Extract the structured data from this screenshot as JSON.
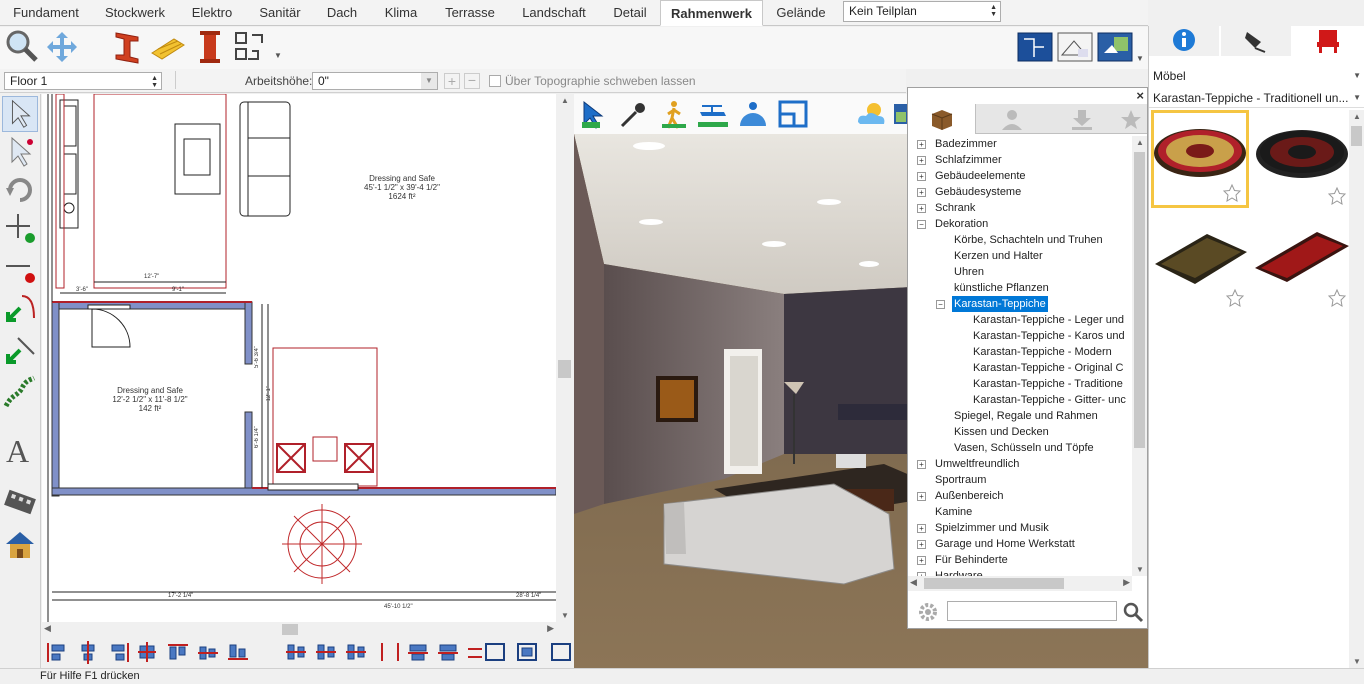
{
  "tabs": [
    {
      "label": "Fundament"
    },
    {
      "label": "Stockwerk"
    },
    {
      "label": "Elektro"
    },
    {
      "label": "Sanitär"
    },
    {
      "label": "Dach"
    },
    {
      "label": "Klima"
    },
    {
      "label": "Terrasse"
    },
    {
      "label": "Landschaft"
    },
    {
      "label": "Detail"
    },
    {
      "label": "Rahmenwerk"
    },
    {
      "label": "Gelände"
    }
  ],
  "active_tab": "Rahmenwerk",
  "plan_select": {
    "value": "Kein Teilplan"
  },
  "floor_select": {
    "value": "Floor 1"
  },
  "arbeitshoehe": {
    "label": "Arbeitshöhe:",
    "value": "0\""
  },
  "float_checkbox": {
    "label": "Über Topographie schweben lassen",
    "checked": false
  },
  "plan": {
    "room1": {
      "name": "Dressing and Safe",
      "dims": "45'-1 1/2\" x 39'-4 1/2\"",
      "area": "1624 ft²"
    },
    "room2": {
      "name": "Dressing and Safe",
      "dims": "12'-2 1/2\" x 11'-8 1/2\"",
      "area": "142 ft²"
    },
    "dims": {
      "d1": "12'-7\"",
      "d2": "9'-1\"",
      "d3": "3'-6\"",
      "d4": "5'-6 3/4\"",
      "d5": "12'-1\"",
      "d6": "6'-6 1/4\"",
      "d7": "17'-2 1/4\"",
      "d8": "45'-10 1/2\"",
      "d9": "28'-8 1/4\""
    }
  },
  "library": {
    "tree": [
      {
        "label": "Badezimmer",
        "level": 0,
        "expandable": true
      },
      {
        "label": "Schlafzimmer",
        "level": 0,
        "expandable": true
      },
      {
        "label": "Gebäudeelemente",
        "level": 0,
        "expandable": true
      },
      {
        "label": "Gebäudesysteme",
        "level": 0,
        "expandable": true
      },
      {
        "label": "Schrank",
        "level": 0,
        "expandable": true
      },
      {
        "label": "Dekoration",
        "level": 0,
        "expandable": true,
        "expanded": true
      },
      {
        "label": "Körbe, Schachteln und Truhen",
        "level": 1
      },
      {
        "label": "Kerzen und Halter",
        "level": 1
      },
      {
        "label": "Uhren",
        "level": 1
      },
      {
        "label": "künstliche Pflanzen",
        "level": 1
      },
      {
        "label": "Karastan-Teppiche",
        "level": 1,
        "expandable": true,
        "expanded": true,
        "selected": true
      },
      {
        "label": "Karastan-Teppiche - Leger und",
        "level": 2
      },
      {
        "label": "Karastan-Teppiche - Karos und",
        "level": 2
      },
      {
        "label": "Karastan-Teppiche - Modern",
        "level": 2
      },
      {
        "label": "Karastan-Teppiche - Original C",
        "level": 2
      },
      {
        "label": "Karastan-Teppiche - Traditione",
        "level": 2
      },
      {
        "label": "Karastan-Teppiche - Gitter- unc",
        "level": 2
      },
      {
        "label": "Spiegel, Regale und Rahmen",
        "level": 1
      },
      {
        "label": "Kissen und Decken",
        "level": 1
      },
      {
        "label": "Vasen, Schüsseln und Töpfe",
        "level": 1
      },
      {
        "label": "Umweltfreundlich",
        "level": 0,
        "expandable": true
      },
      {
        "label": "Sportraum",
        "level": 0
      },
      {
        "label": "Außenbereich",
        "level": 0,
        "expandable": true
      },
      {
        "label": "Kamine",
        "level": 0
      },
      {
        "label": "Spielzimmer und Musik",
        "level": 0,
        "expandable": true
      },
      {
        "label": "Garage und Home Werkstatt",
        "level": 0,
        "expandable": true
      },
      {
        "label": "Für Behinderte",
        "level": 0,
        "expandable": true
      },
      {
        "label": "Hardware",
        "level": 0,
        "expandable": true
      }
    ],
    "search_placeholder": ""
  },
  "right_panel": {
    "category": "Möbel",
    "subcategory": "Karastan-Teppiche - Traditionell un...",
    "thumbnails": [
      {
        "name": "round-rug-gold",
        "selected": true
      },
      {
        "name": "round-rug-dark",
        "selected": false
      },
      {
        "name": "rect-rug-dark",
        "selected": false
      },
      {
        "name": "rect-rug-red",
        "selected": false
      }
    ]
  },
  "status": {
    "text": "Für Hilfe F1 drücken"
  },
  "colors": {
    "accent": "#0a64d6",
    "selection": "#0078d7",
    "wall_red": "#b0202a",
    "wall_blue": "#8090c8",
    "thumb_selected": "#f5c542"
  }
}
